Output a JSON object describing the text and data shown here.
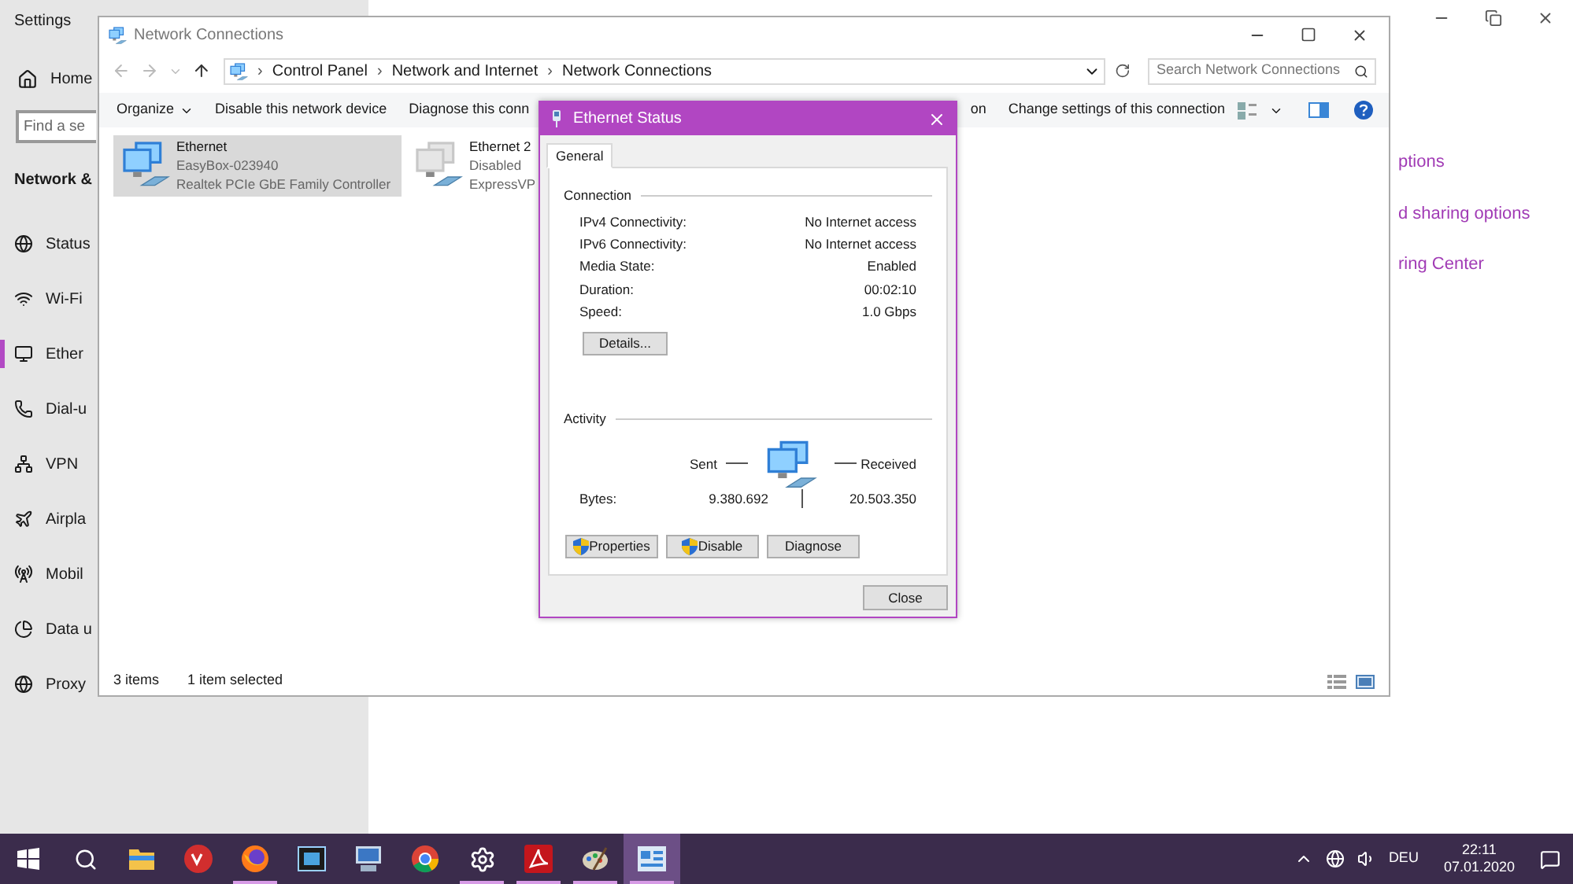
{
  "settings": {
    "title": "Settings",
    "home": "Home",
    "search": {
      "placeholder": "Find a se"
    },
    "section": "Network &",
    "nav": [
      {
        "label": "Status",
        "kind": "status",
        "selected": false
      },
      {
        "label": "Wi-Fi",
        "kind": "wifi",
        "selected": false
      },
      {
        "label": "Ether",
        "kind": "ethernet",
        "selected": true
      },
      {
        "label": "Dial-u",
        "kind": "dialup",
        "selected": false
      },
      {
        "label": "VPN",
        "kind": "vpn",
        "selected": false
      },
      {
        "label": "Airpla",
        "kind": "airplane",
        "selected": false
      },
      {
        "label": "Mobil",
        "kind": "mobile",
        "selected": false
      },
      {
        "label": "Data u",
        "kind": "data",
        "selected": false
      },
      {
        "label": "Proxy",
        "kind": "proxy",
        "selected": false
      }
    ],
    "links": [
      "ptions",
      "d sharing options",
      "ring Center"
    ]
  },
  "explorer": {
    "title": "Network Connections",
    "breadcrumb": [
      {
        "separator": "›",
        "label": "Control Panel"
      },
      {
        "separator": "›",
        "label": "Network and Internet"
      },
      {
        "separator": "›",
        "label": "Network Connections"
      }
    ],
    "search": {
      "placeholder": "Search Network Connections"
    },
    "toolbar": [
      {
        "label": "Organize",
        "menu": true
      },
      {
        "label": "Disable this network device",
        "menu": false
      },
      {
        "label": "Diagnose this conn",
        "menu": false
      }
    ],
    "toolbar_right": [
      "on",
      "Change settings of this connection"
    ],
    "connections": [
      {
        "name": "Ethernet",
        "network": "EasyBox-023940",
        "adapter": "Realtek PCIe GbE Family Controller",
        "selected": true,
        "disabled": false
      },
      {
        "name": "Ethernet 2",
        "network": "Disabled",
        "adapter": "ExpressVP",
        "selected": false,
        "disabled": true
      }
    ],
    "status_bar": {
      "count": "3 items",
      "selection": "1 item selected"
    }
  },
  "dialog": {
    "title": "Ethernet Status",
    "tabs": [
      {
        "label": "General",
        "selected": true
      }
    ],
    "connection": {
      "heading": "Connection",
      "rows": [
        {
          "label": "IPv4 Connectivity:",
          "value": "No Internet access"
        },
        {
          "label": "IPv6 Connectivity:",
          "value": "No Internet access"
        },
        {
          "label": "Media State:",
          "value": "Enabled"
        },
        {
          "label": "Duration:",
          "value": "00:02:10"
        },
        {
          "label": "Speed:",
          "value": "1.0 Gbps"
        }
      ],
      "details": "Details..."
    },
    "activity": {
      "heading": "Activity",
      "sent": "Sent",
      "received": "Received",
      "bytes_label": "Bytes:",
      "sent_bytes": "9.380.692",
      "received_bytes": "20.503.350"
    },
    "buttons": [
      {
        "label": "Properties",
        "shield": true
      },
      {
        "label": "Disable",
        "shield": true
      },
      {
        "label": "Diagnose",
        "shield": false
      }
    ],
    "close": "Close"
  },
  "taskbar": {
    "apps": [
      {
        "kind": "start",
        "running": false,
        "selected": false
      },
      {
        "kind": "search",
        "running": false,
        "selected": false
      },
      {
        "kind": "folder",
        "running": false,
        "selected": false
      },
      {
        "kind": "vpn",
        "running": false,
        "selected": false
      },
      {
        "kind": "firefox",
        "running": true,
        "selected": false
      },
      {
        "kind": "film",
        "running": false,
        "selected": false
      },
      {
        "kind": "computer",
        "running": false,
        "selected": false
      },
      {
        "kind": "chrome",
        "running": false,
        "selected": false
      },
      {
        "kind": "gear",
        "running": true,
        "selected": false
      },
      {
        "kind": "pdf",
        "running": true,
        "selected": false
      },
      {
        "kind": "paint",
        "running": true,
        "selected": false
      },
      {
        "kind": "network",
        "running": true,
        "selected": true
      }
    ],
    "language": "DEU",
    "time": "22:11",
    "date": "07.01.2020"
  }
}
